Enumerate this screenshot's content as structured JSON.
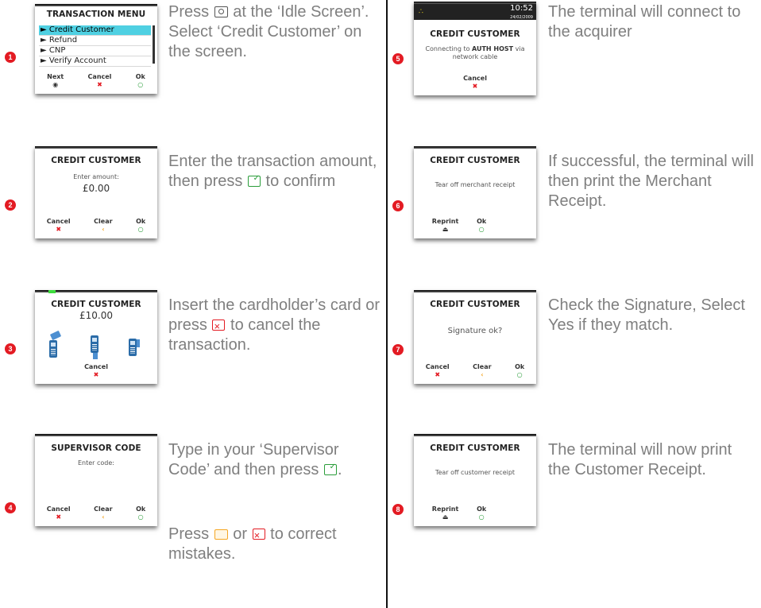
{
  "steps": [
    {
      "number": "1",
      "screen": {
        "title": "TRANSACTION MENU",
        "menu": [
          "Credit Customer",
          "Refund",
          "CNP",
          "Verify Account"
        ],
        "softkeys": [
          {
            "label": "Next"
          },
          {
            "label": "Cancel"
          },
          {
            "label": "Ok"
          }
        ]
      },
      "text": {
        "a": "Press ",
        "b": " at the ‘Idle Screen’. Select ‘Credit Customer’ on the screen."
      }
    },
    {
      "number": "2",
      "screen": {
        "title": "CREDIT CUSTOMER",
        "line1": "Enter amount:",
        "amount": "£0.00",
        "softkeys": [
          {
            "label": "Cancel"
          },
          {
            "label": "Clear"
          },
          {
            "label": "Ok"
          }
        ]
      },
      "text": {
        "a": "Enter the transaction amount, then press ",
        "b": " to confirm"
      }
    },
    {
      "number": "3",
      "screen": {
        "title": "CREDIT CUSTOMER",
        "amount": "£10.00",
        "softkeys": [
          {
            "label": "Cancel"
          }
        ]
      },
      "text": {
        "a": "Insert the cardholder’s card or press ",
        "b": " to cancel the transaction."
      }
    },
    {
      "number": "4",
      "screen": {
        "title": "SUPERVISOR CODE",
        "line1": "Enter code:",
        "softkeys": [
          {
            "label": "Cancel"
          },
          {
            "label": "Clear"
          },
          {
            "label": "Ok"
          }
        ]
      },
      "text": {
        "a": "Type in your ‘Supervisor Code’ and then press ",
        "b": ".",
        "c": "Press ",
        "d": " or ",
        "e": " to correct mistakes."
      }
    },
    {
      "number": "5",
      "screen": {
        "time": "10:52",
        "date": "24/02/2009",
        "title": "CREDIT CUSTOMER",
        "line1a": "Connecting to ",
        "line1b": "AUTH HOST",
        "line1c": " via",
        "line2": "network cable",
        "softkeys": [
          {
            "label": "Cancel"
          }
        ]
      },
      "text": {
        "a": "The terminal will connect to the acquirer"
      }
    },
    {
      "number": "6",
      "screen": {
        "title": "CREDIT CUSTOMER",
        "line1": "Tear off merchant receipt",
        "softkeys": [
          {
            "label": "Reprint"
          },
          {
            "label": "Ok"
          }
        ]
      },
      "text": {
        "a": "If successful, the terminal will then print the Merchant Receipt."
      }
    },
    {
      "number": "7",
      "screen": {
        "title": "CREDIT CUSTOMER",
        "line1": "Signature ok?",
        "softkeys": [
          {
            "label": "Cancel"
          },
          {
            "label": "Clear"
          },
          {
            "label": "Ok"
          }
        ]
      },
      "text": {
        "a": "Check the Signature, Select Yes if they match."
      }
    },
    {
      "number": "8",
      "screen": {
        "title": "CREDIT CUSTOMER",
        "line1": "Tear off customer receipt",
        "softkeys": [
          {
            "label": "Reprint"
          },
          {
            "label": "Ok"
          }
        ]
      },
      "text": {
        "a": "The terminal will now print the Customer Receipt."
      }
    }
  ],
  "colors": {
    "badge": "#e31b23",
    "highlight": "#4fd0e2",
    "text": "#7f7f7f",
    "cancel": "#e31b23",
    "clear": "#f5a623",
    "ok": "#2a9d3a"
  },
  "icons": {
    "menu_key": "menu-key-icon",
    "ok_key": "ok-key-icon",
    "cancel_key": "cancel-key-icon",
    "clear_key": "clear-key-icon"
  }
}
